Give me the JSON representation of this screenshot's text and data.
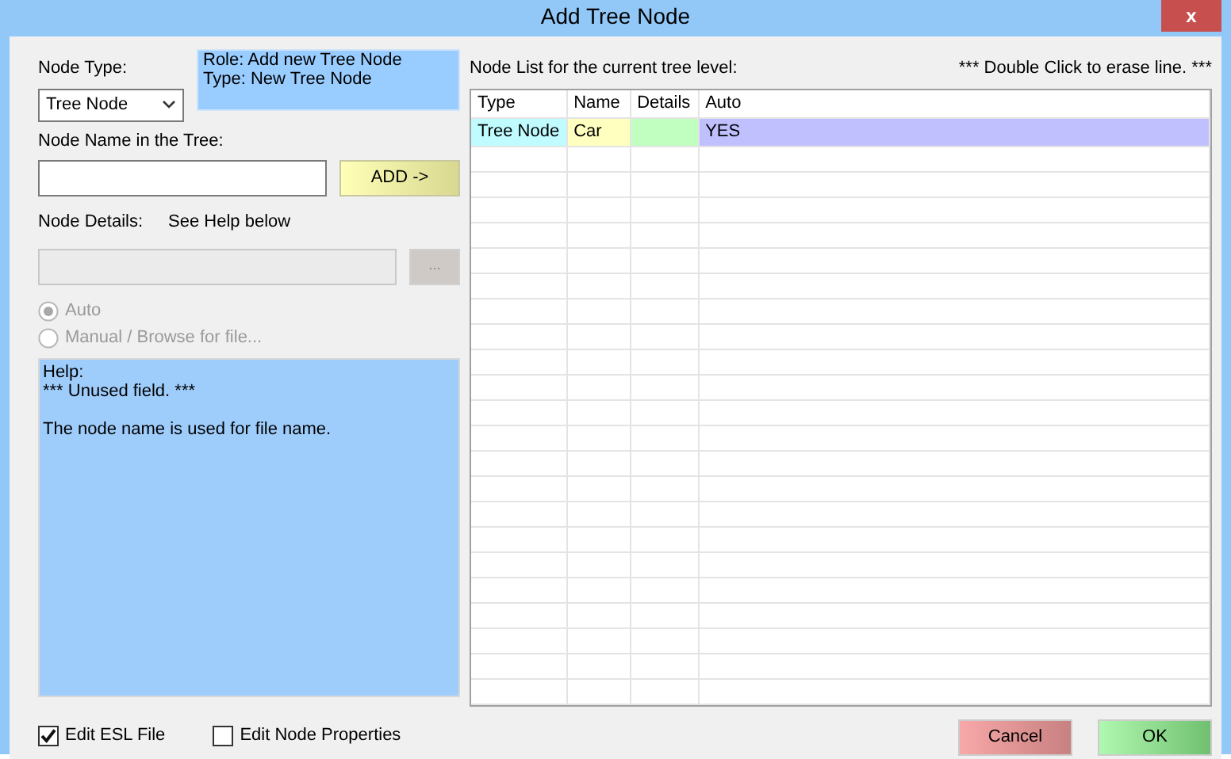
{
  "window": {
    "title": "Add Tree Node",
    "close": "x"
  },
  "node_type": {
    "label": "Node Type:",
    "value": "Tree Node"
  },
  "info": [
    "Role: Add new Tree Node",
    "Type: New Tree Node"
  ],
  "node_name": {
    "label": "Node Name in the Tree:",
    "add_button": "ADD ->"
  },
  "node_details": {
    "label": "Node Details:",
    "hint": "See Help below",
    "disabled": true,
    "browse_button": "..."
  },
  "radios": [
    {
      "label": "Auto",
      "selected": true,
      "disabled": true
    },
    {
      "label": "Manual / Browse for file...",
      "selected": false,
      "disabled": true
    }
  ],
  "help": [
    "Help:",
    "*** Unused field. ***",
    "The node name is used for file name."
  ],
  "checkboxes": [
    {
      "label": "Edit ESL File",
      "checked": true
    },
    {
      "label": "Edit Node Properties",
      "checked": false
    }
  ],
  "node_list": {
    "label": "Node List for the current tree level:",
    "note": "*** Double Click to erase line. ***",
    "columns": [
      {
        "label": "Type",
        "color": "#c0fbff"
      },
      {
        "label": "Name",
        "color": "#ffffc0"
      },
      {
        "label": "Details",
        "color": "#c0ffc0"
      },
      {
        "label": "Auto",
        "color": "#c0c0ff"
      }
    ],
    "rows": [
      [
        "Tree Node",
        "Car",
        "",
        "YES"
      ]
    ]
  },
  "buttons": [
    {
      "kind": "cancel",
      "label": "Cancel"
    },
    {
      "kind": "ok",
      "label": "OK"
    }
  ]
}
